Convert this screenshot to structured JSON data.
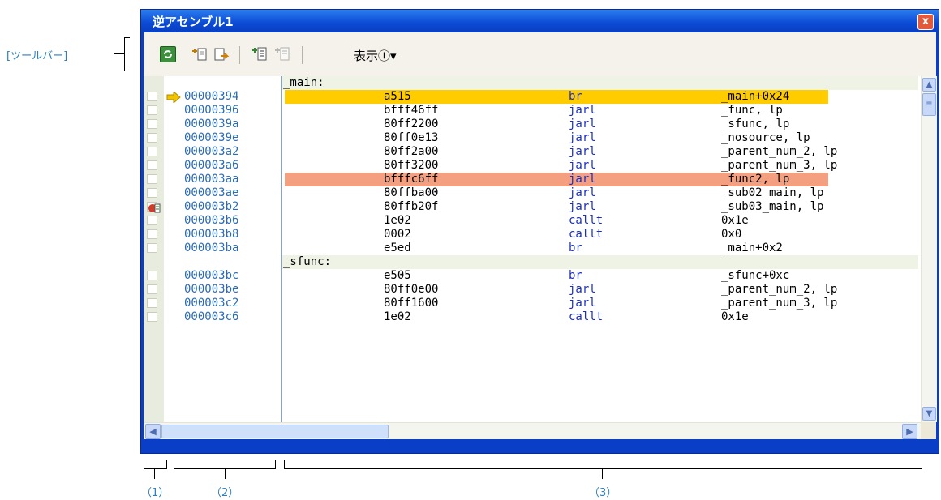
{
  "callouts": {
    "toolbar": "[ツールバー]",
    "c1": "（1）",
    "c2": "（2）",
    "c3": "（3）"
  },
  "window": {
    "title": "逆アセンブル1",
    "close_label": "x",
    "view_menu_label": "表示Ⓘ▾"
  },
  "toolbar_icons": [
    "refresh-icon",
    "go-to-icon",
    "save-icon",
    "mix-display-icon",
    "disassemble-only-icon"
  ],
  "scroll_glyphs": {
    "up": "▲",
    "down": "▼",
    "left": "◀",
    "right": "▶",
    "grip": "≡"
  },
  "labels": {
    "main": "_main:",
    "sfunc": "_sfunc:"
  },
  "rows_main": [
    {
      "addr": "00000394",
      "code": "a515",
      "mnem": "br",
      "operand": "_main+0x24",
      "highlight": "pc"
    },
    {
      "addr": "00000396",
      "code": "bfff46ff",
      "mnem": "jarl",
      "operand": "_func, lp"
    },
    {
      "addr": "0000039a",
      "code": "80ff2200",
      "mnem": "jarl",
      "operand": "_sfunc, lp"
    },
    {
      "addr": "0000039e",
      "code": "80ff0e13",
      "mnem": "jarl",
      "operand": "_nosource, lp"
    },
    {
      "addr": "000003a2",
      "code": "80ff2a00",
      "mnem": "jarl",
      "operand": "_parent_num_2, lp"
    },
    {
      "addr": "000003a6",
      "code": "80ff3200",
      "mnem": "jarl",
      "operand": "_parent_num_3, lp"
    },
    {
      "addr": "000003aa",
      "code": "bfffc6ff",
      "mnem": "jarl",
      "operand": "_func2, lp",
      "highlight": "bp"
    },
    {
      "addr": "000003ae",
      "code": "80ffba00",
      "mnem": "jarl",
      "operand": "_sub02_main, lp"
    },
    {
      "addr": "000003b2",
      "code": "80ffb20f",
      "mnem": "jarl",
      "operand": "_sub03_main, lp"
    },
    {
      "addr": "000003b6",
      "code": "1e02",
      "mnem": "callt",
      "operand": "0x1e"
    },
    {
      "addr": "000003b8",
      "code": "0002",
      "mnem": "callt",
      "operand": "0x0"
    },
    {
      "addr": "000003ba",
      "code": "e5ed",
      "mnem": "br",
      "operand": "_main+0x2"
    }
  ],
  "rows_sfunc": [
    {
      "addr": "000003bc",
      "code": "e505",
      "mnem": "br",
      "operand": "_sfunc+0xc"
    },
    {
      "addr": "000003be",
      "code": "80ff0e00",
      "mnem": "jarl",
      "operand": "_parent_num_2, lp"
    },
    {
      "addr": "000003c2",
      "code": "80ff1600",
      "mnem": "jarl",
      "operand": "_parent_num_3, lp"
    },
    {
      "addr": "000003c6",
      "code": "1e02",
      "mnem": "callt",
      "operand": "0x1e"
    }
  ],
  "colors": {
    "pc_highlight": "#ffcc00",
    "bp_highlight": "#f4a080",
    "label_row": "#eef3e6",
    "title_bar": "#0b4ad4"
  }
}
